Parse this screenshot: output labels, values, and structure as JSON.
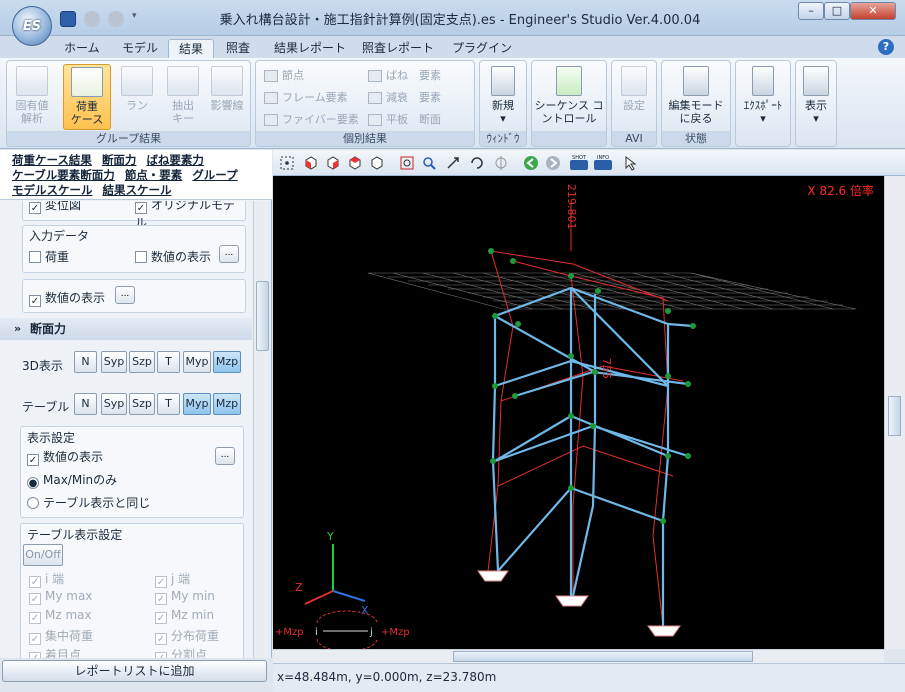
{
  "window": {
    "title": "乗入れ構台設計・施工指針計算例(固定支点).es - Engineer's Studio Ver.4.00.04",
    "app_logo": "ES"
  },
  "tabs": [
    {
      "label": "ホーム"
    },
    {
      "label": "モデル"
    },
    {
      "label": "結果"
    },
    {
      "label": "照査"
    },
    {
      "label": "結果レポート"
    },
    {
      "label": "照査レポート"
    },
    {
      "label": "プラグイン"
    }
  ],
  "ribbon": {
    "group_results": {
      "label": "グループ結果",
      "buttons": [
        {
          "label1": "固有値",
          "label2": "解析"
        },
        {
          "label1": "荷重",
          "label2": "ケース"
        },
        {
          "label1": "ラン",
          "label2": ""
        },
        {
          "label1": "抽出",
          "label2": "キー"
        },
        {
          "label1": "影響線",
          "label2": ""
        }
      ]
    },
    "individual_results": {
      "label": "個別結果",
      "items": [
        "節点",
        "フレーム要素",
        "ファイバー要素",
        "ばね　要素",
        "減衰　要素",
        "平板　断面"
      ]
    },
    "window_group": {
      "label": "ｳｨﾝﾄﾞｳ",
      "new": "新規"
    },
    "sequence": {
      "label1": "シーケンス コ",
      "label2": "ントロール"
    },
    "avi": {
      "label": "AVI",
      "settings": "設定"
    },
    "state": {
      "label": "状態",
      "edit1": "編集モード",
      "edit2": "に戻る"
    },
    "export": {
      "label": "ｴｸｽﾎﾟｰﾄ"
    },
    "display": {
      "label": "表示"
    }
  },
  "left_panel": {
    "links": [
      "荷重ケース結果",
      "断面力",
      "ばね要素力",
      "ケーブル要素断面力",
      "節点・要素",
      "グループ",
      "モデルスケール",
      "結果スケール"
    ],
    "clipped_top": [
      "変位図",
      "オリジナルモデル"
    ],
    "input_data": {
      "title": "入力データ",
      "load": "荷重",
      "show_values": "数値の表示"
    },
    "show_values_2": "数値の表示",
    "section_force": {
      "title": "断面力",
      "row_3d_label": "3D表示",
      "row_table_label": "テーブル",
      "buttons": [
        "N",
        "Syp",
        "Szp",
        "T",
        "Myp",
        "Mzp"
      ]
    },
    "display_settings": {
      "title": "表示設定",
      "show_values": "数値の表示",
      "radio1": "Max/Minのみ",
      "radio2": "テーブル表示と同じ"
    },
    "table_settings": {
      "title": "テーブル表示設定",
      "onoff": "On/Off",
      "items_left": [
        "i 端",
        "My max",
        "Mz max",
        "集中荷重",
        "着目点"
      ],
      "items_right": [
        "j 端",
        "My min",
        "Mz min",
        "分布荷重",
        "分割点"
      ]
    },
    "footer_button": "レポートリストに追加"
  },
  "viewport": {
    "scale_label": "X 82.6 倍率",
    "value_top": "219.801",
    "value_mid": "755",
    "axis": {
      "y": "Y",
      "z": "Z",
      "x": "X"
    },
    "moment_left": "+Mzp",
    "moment_right": "+Mzp",
    "moment_i": "i",
    "moment_j": "j"
  },
  "status": {
    "coords": "x=48.484m, y=0.000m, z=23.780m"
  }
}
